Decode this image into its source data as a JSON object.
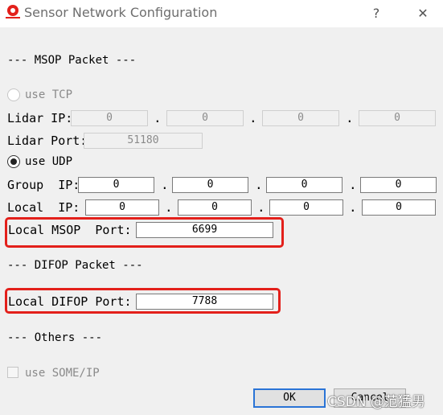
{
  "window": {
    "title": "Sensor Network Configuration",
    "help_label": "?",
    "close_label": "✕",
    "logo_icon": "robosense-logo"
  },
  "msop": {
    "header": "--- MSOP Packet ---",
    "tcp": {
      "label": "use TCP",
      "lidar_ip_label": "Lidar IP:",
      "lidar_ip": [
        "0",
        "0",
        "0",
        "0"
      ],
      "lidar_port_label": "Lidar Port:",
      "lidar_port": "51180"
    },
    "udp": {
      "label": "use UDP",
      "group_ip_label": "Group  IP:",
      "group_ip": [
        "0",
        "0",
        "0",
        "0"
      ],
      "local_ip_label": "Local  IP:",
      "local_ip": [
        "0",
        "0",
        "0",
        "0"
      ],
      "local_msop_port_label": "Local MSOP  Port:",
      "local_msop_port": "6699"
    }
  },
  "difop": {
    "header": "--- DIFOP Packet ---",
    "local_difop_port_label": "Local DIFOP Port:",
    "local_difop_port": "7788"
  },
  "others": {
    "header": "--- Others ---",
    "someip_label": "use SOME/IP"
  },
  "buttons": {
    "ok": "OK",
    "cancel": "Cancel"
  },
  "watermark": "CSDN @范猛男",
  "colors": {
    "highlight": "#e3201b",
    "focus_border": "#2a74d6"
  }
}
